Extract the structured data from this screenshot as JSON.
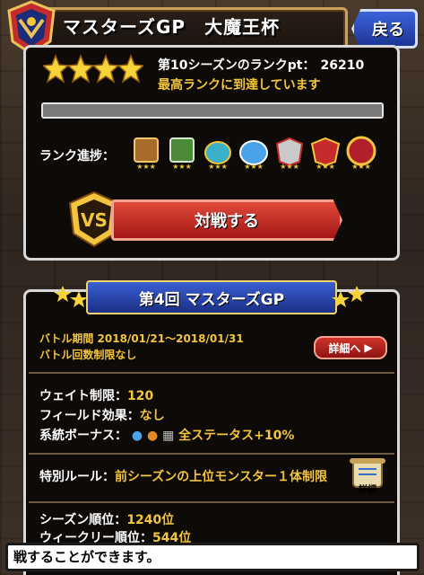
{
  "header": {
    "title": "マスターズGP　大魔王杯",
    "back_label": "戻る"
  },
  "season": {
    "rank_label": "第10シーズンのランクpt：",
    "rank_value": "26210",
    "message": "最高ランクに到達しています",
    "star_count": 4,
    "progress_fraction": 1.0
  },
  "rank_progress": {
    "label": "ランク進捗：",
    "icons": [
      "bronze-rank-icon",
      "silver-rank-icon",
      "gold-rank-icon",
      "platinum-rank-icon",
      "diamond-rank-icon",
      "master-rank-icon",
      "grandmaster-rank-icon"
    ]
  },
  "battle": {
    "button_label": "対戦する"
  },
  "event": {
    "banner_title": "第4回 マスターズGP",
    "period_label": "バトル期間 2018/01/21～2018/01/31",
    "limit_label": "バトル回数制限なし",
    "detail_label": "詳細へ",
    "weight_label": "ウェイト制限：",
    "weight_value": "120",
    "field_label": "フィールド効果：",
    "field_value": "なし",
    "bonus_label": "系統ボーナス：",
    "bonus_value": "全ステータス+10%",
    "special_label": "特別ルール：",
    "special_value": "前シーズンの上位モンスター１体制限",
    "special_detail_label": "詳細",
    "season_rank_label": "シーズン順位：",
    "season_rank_value": "1240位",
    "weekly_rank_label": "ウィークリー順位：",
    "weekly_rank_value": "544位"
  },
  "message_bar": {
    "text": "戦することができます。"
  },
  "colors": {
    "accent_gold": "#f3c53c",
    "battle_red": "#c72a22",
    "banner_blue": "#2a48b0"
  }
}
